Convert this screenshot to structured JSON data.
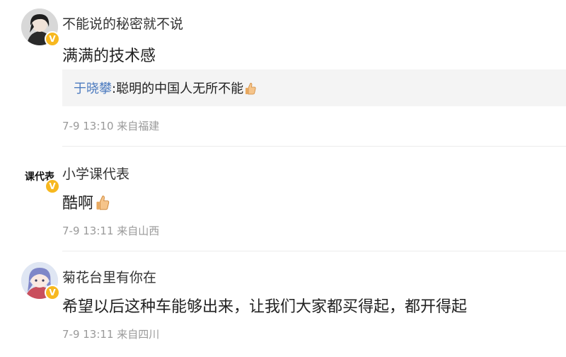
{
  "comments": [
    {
      "username": "不能说的秘密就不说",
      "text": "满满的技术感",
      "verified_badge": "V",
      "avatar_icon": "dark-haired-person-avatar",
      "reply": {
        "user": "于晓攀",
        "separator": ":",
        "text": "聪明的中国人无所不能",
        "emoji": "thumbs-up-icon"
      },
      "meta": "7-9 13:10 来自福建"
    },
    {
      "username": "小学课代表",
      "text": "酷啊",
      "emoji": "thumbs-up-icon",
      "verified_badge": "V",
      "avatar_icon": "logo-avatar",
      "avatar_logo_text": "课代表",
      "meta": "7-9 13:11 来自山西"
    },
    {
      "username": "菊花台里有你在",
      "text": "希望以后这种车能够出来，让我们大家都买得起，都开得起",
      "verified_badge": "V",
      "avatar_icon": "anime-girl-avatar",
      "meta": "7-9 13:11 来自四川"
    }
  ],
  "colors": {
    "reply_user": "#4d7bbf",
    "badge": "#f7b81f",
    "meta": "#9a9a9a",
    "reply_bg": "#f4f4f4"
  }
}
